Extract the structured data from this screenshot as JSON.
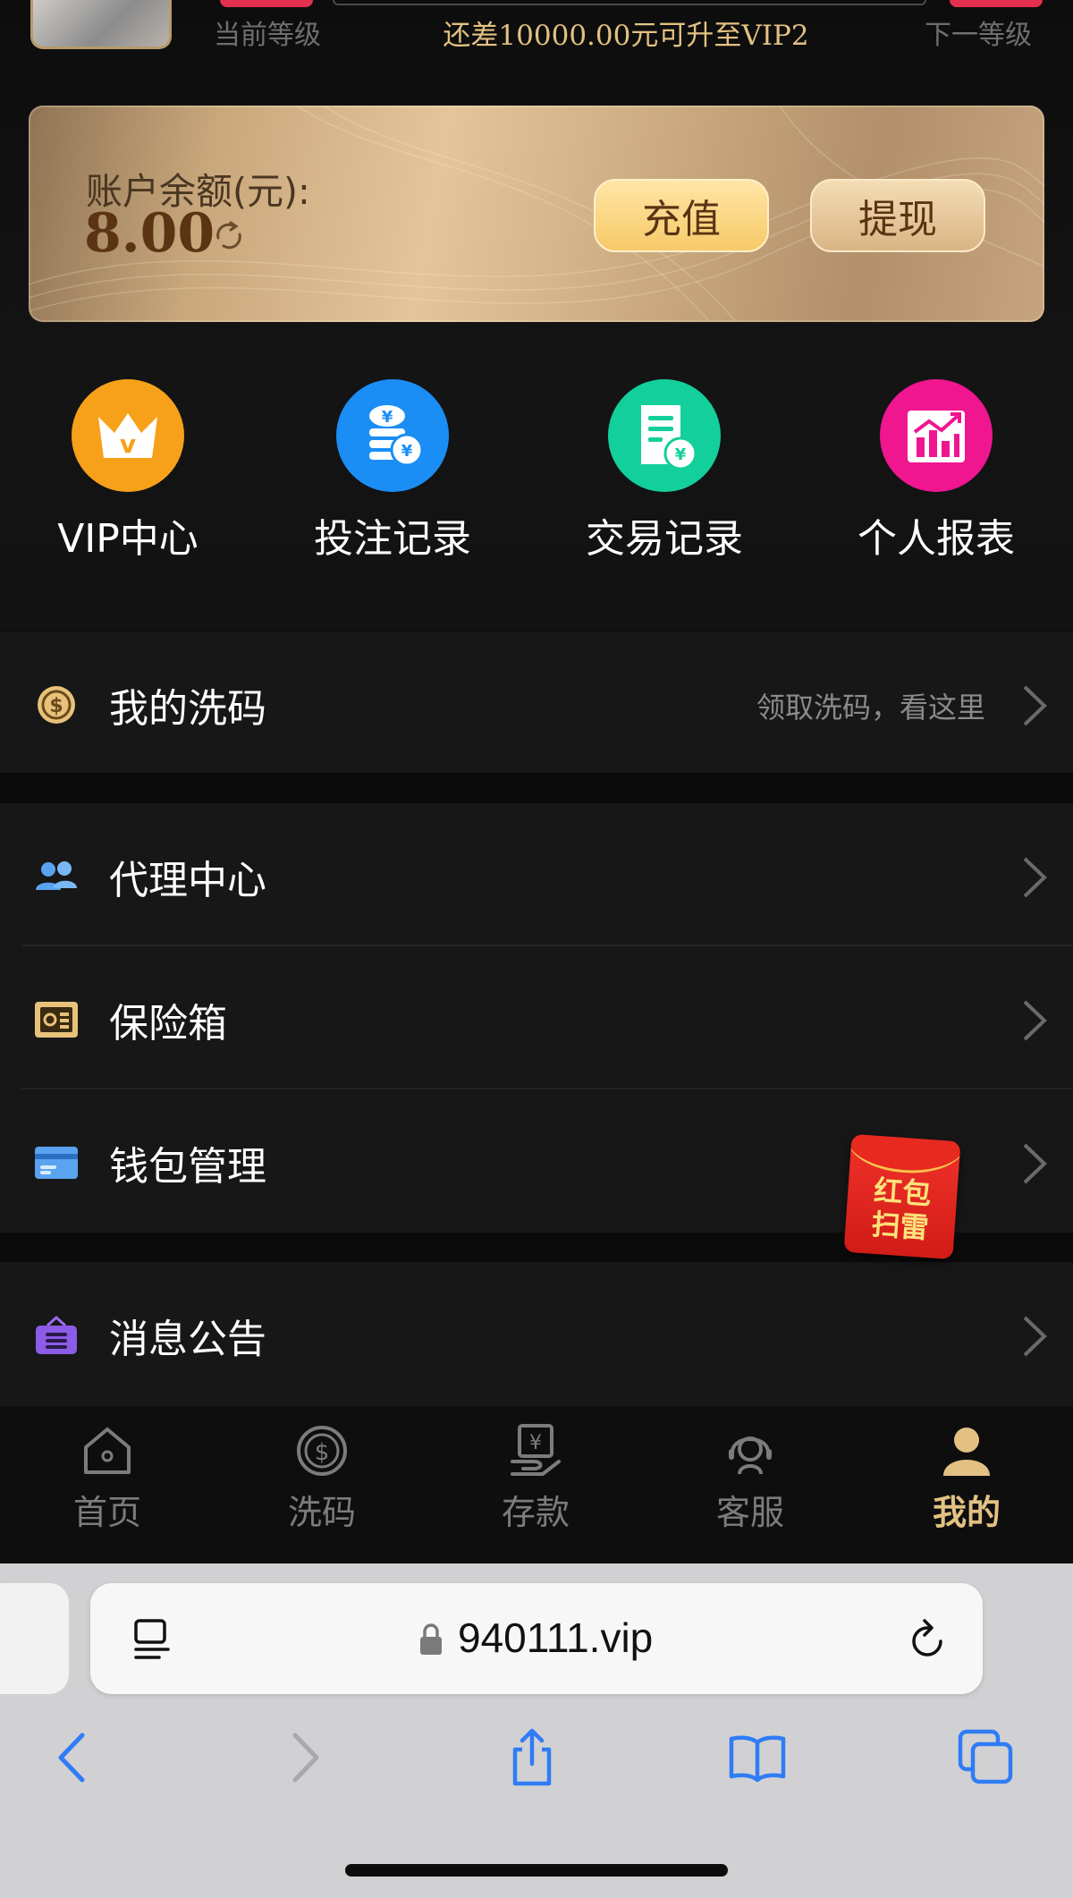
{
  "vip": {
    "current_level_label": "当前等级",
    "next_level_label": "下一等级",
    "upgrade_tip": "还差10000.00元可升至VIP2"
  },
  "balance": {
    "label": "账户余额(元):",
    "amount": "8.00",
    "recharge_label": "充值",
    "withdraw_label": "提现"
  },
  "shortcuts": [
    {
      "label": "VIP中心",
      "icon": "crown-icon",
      "color": "#f7a11a"
    },
    {
      "label": "投注记录",
      "icon": "coins-icon",
      "color": "#1a8ef5"
    },
    {
      "label": "交易记录",
      "icon": "receipt-icon",
      "color": "#13cf9c"
    },
    {
      "label": "个人报表",
      "icon": "chart-icon",
      "color": "#f01690"
    }
  ],
  "menu": {
    "wash": {
      "title": "我的洗码",
      "hint": "领取洗码，看这里"
    },
    "agent": {
      "title": "代理中心"
    },
    "safe": {
      "title": "保险箱"
    },
    "wallet": {
      "title": "钱包管理"
    },
    "notice": {
      "title": "消息公告"
    }
  },
  "red_envelope": {
    "line1": "红包",
    "line2": "扫雷"
  },
  "tabs": [
    {
      "label": "首页",
      "icon": "home-icon"
    },
    {
      "label": "洗码",
      "icon": "coin-icon"
    },
    {
      "label": "存款",
      "icon": "deposit-icon"
    },
    {
      "label": "客服",
      "icon": "support-icon"
    },
    {
      "label": "我的",
      "icon": "user-icon",
      "active": true
    }
  ],
  "browser": {
    "url": "940111.vip"
  }
}
